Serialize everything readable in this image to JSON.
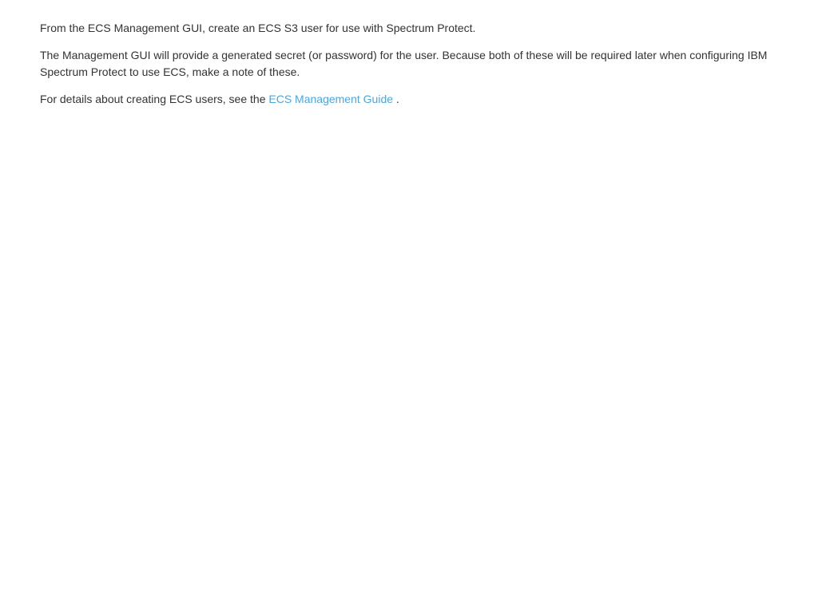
{
  "doc": {
    "p1": "From the ECS Management GUI, create an ECS S3 user for use with Spectrum Protect.",
    "p2": "The Management GUI will provide a generated secret (or password) for the user. Because both of these will be required later when configuring IBM Spectrum Protect to use ECS, make a note of these.",
    "p3_prefix": "For details about creating ECS users, see the ",
    "p3_link": "ECS Management Guide",
    "p3_suffix": " ."
  }
}
